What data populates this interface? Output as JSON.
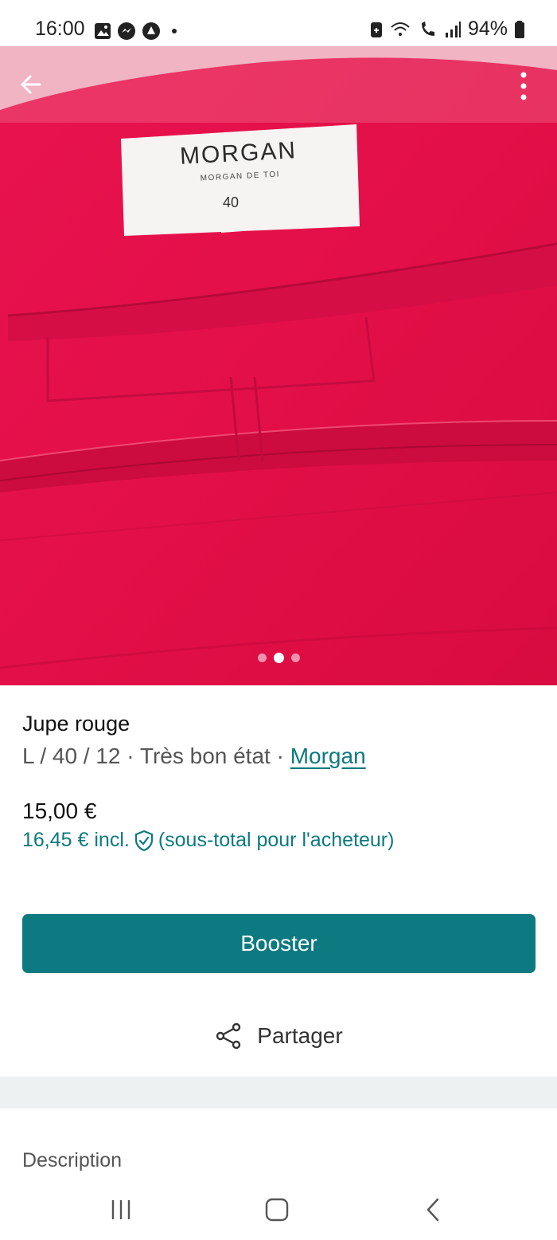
{
  "status_bar": {
    "time": "16:00",
    "battery": "94%",
    "left_icons": [
      "gallery-icon",
      "messenger-icon",
      "app-icon",
      "dot-icon"
    ],
    "right_icons": [
      "battery-saver-icon",
      "wifi-calling-icon",
      "vowifi-icon",
      "signal-icon",
      "battery-icon"
    ]
  },
  "image": {
    "label_brand": "MORGAN",
    "label_sub": "MORGAN DE TOI",
    "label_size": "40",
    "carousel": {
      "total": 3,
      "active_index": 1
    },
    "photo_color": "#e0124a"
  },
  "item": {
    "title": "Jupe rouge",
    "meta_prefix": "L / 40 / 12 · Très bon état · ",
    "brand": "Morgan",
    "price": "15,00 €",
    "price_incl": "16,45 € incl.",
    "price_incl_note": "(sous-total pour l'acheteur)"
  },
  "actions": {
    "booster_label": "Booster",
    "share_label": "Partager"
  },
  "section": {
    "description_label": "Description"
  },
  "colors": {
    "accent": "#0c7a80",
    "band": "#edf1f2"
  }
}
